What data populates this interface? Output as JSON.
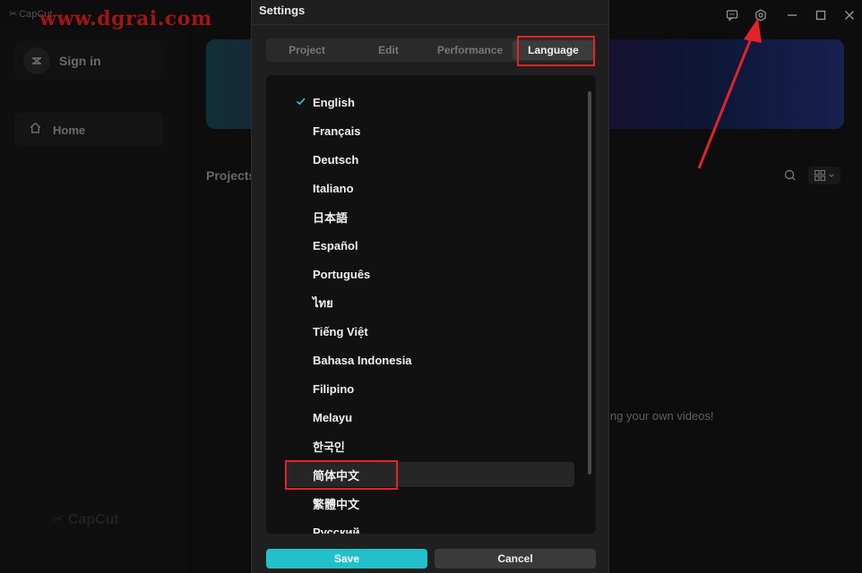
{
  "app": {
    "name": "CapCut",
    "name_glyph": "✂"
  },
  "watermark": "www.dgrai.com",
  "window_controls": [
    "feedback-icon",
    "settings-icon",
    "minimize-icon",
    "maximize-icon",
    "close-icon"
  ],
  "sidebar": {
    "sign_in_label": "Sign in",
    "nav": [
      {
        "label": "Home",
        "icon": "home-icon"
      }
    ],
    "footer_brand": "CapCut"
  },
  "main": {
    "projects_title": "Projects",
    "empty_hint": "ing your own videos!"
  },
  "settings": {
    "title": "Settings",
    "tabs": [
      {
        "label": "Project",
        "active": false
      },
      {
        "label": "Edit",
        "active": false
      },
      {
        "label": "Performance",
        "active": false
      },
      {
        "label": "Language",
        "active": true
      }
    ],
    "languages": [
      {
        "label": "English",
        "selected": true
      },
      {
        "label": "Français"
      },
      {
        "label": "Deutsch"
      },
      {
        "label": "Italiano"
      },
      {
        "label": "日本語"
      },
      {
        "label": "Español"
      },
      {
        "label": "Português"
      },
      {
        "label": "ไทย"
      },
      {
        "label": "Tiếng Việt"
      },
      {
        "label": "Bahasa Indonesia"
      },
      {
        "label": "Filipino"
      },
      {
        "label": "Melayu"
      },
      {
        "label": "한국인"
      },
      {
        "label": "简体中文",
        "hovered": true
      },
      {
        "label": "繁體中文"
      },
      {
        "label": "Русский"
      }
    ],
    "save_label": "Save",
    "cancel_label": "Cancel"
  },
  "colors": {
    "accent": "#22c0cb",
    "check": "#2fd1d8",
    "annotation": "#e2242a"
  }
}
